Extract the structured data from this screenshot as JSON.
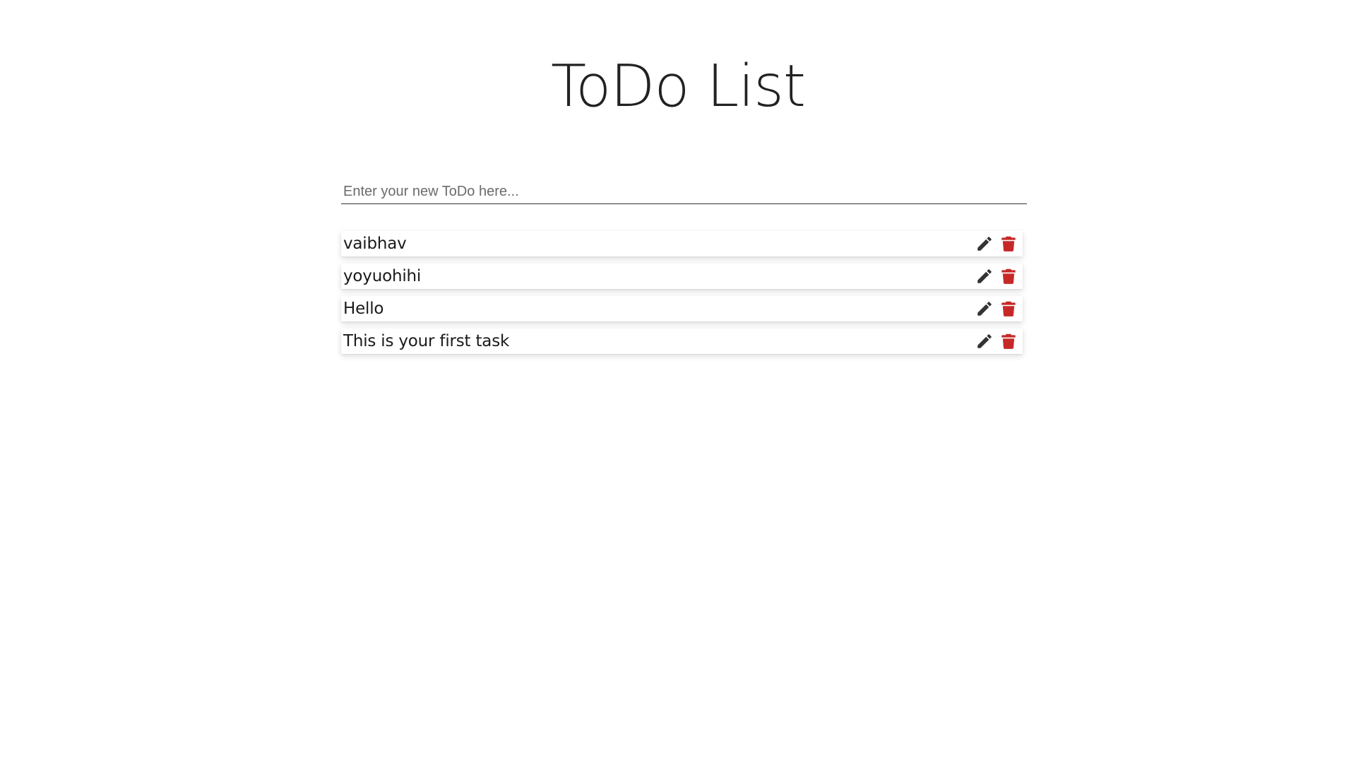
{
  "header": {
    "title": "ToDo List"
  },
  "new_todo": {
    "placeholder": "Enter your new ToDo here...",
    "value": ""
  },
  "todos": [
    {
      "text": "vaibhav"
    },
    {
      "text": "yoyuohihi"
    },
    {
      "text": "Hello"
    },
    {
      "text": "This is your first task"
    }
  ],
  "icons": {
    "edit": "pencil-icon",
    "delete": "trash-icon"
  },
  "colors": {
    "edit_icon": "#333333",
    "delete_icon": "#c62828",
    "title_text": "#222222"
  }
}
